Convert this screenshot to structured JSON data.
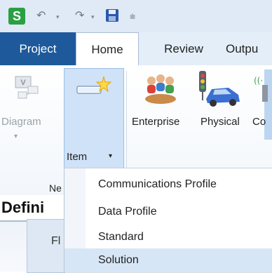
{
  "quick_access": {
    "logo_letter": "S",
    "undo_icon": "undo-icon",
    "redo_icon": "redo-icon",
    "save_icon": "save-icon",
    "customize_icon": "customize-qat-icon"
  },
  "tabs": [
    {
      "label": "Project",
      "active": false
    },
    {
      "label": "Home",
      "active": true
    },
    {
      "label": "Review",
      "active": false
    },
    {
      "label": "Outpu",
      "active": false
    }
  ],
  "ribbon": {
    "diagram_label": "Diagram",
    "item_label": "Item",
    "enterprise_label": "Enterprise",
    "physical_label": "Physical",
    "connection_label": "Co",
    "group_label": "Ne"
  },
  "panel": {
    "title": "Defini",
    "tab_label": "Fl"
  },
  "menu": {
    "items": [
      {
        "label": "Communications Profile",
        "highlighted": false
      },
      {
        "label": "Data Profile",
        "highlighted": false
      },
      {
        "label": "Standard",
        "highlighted": false
      },
      {
        "label": "Solution",
        "highlighted": true
      }
    ]
  },
  "colors": {
    "project_tab": "#1e5a9b",
    "logo_green": "#2aa043",
    "menu_highlight": "#d7e6f6"
  }
}
